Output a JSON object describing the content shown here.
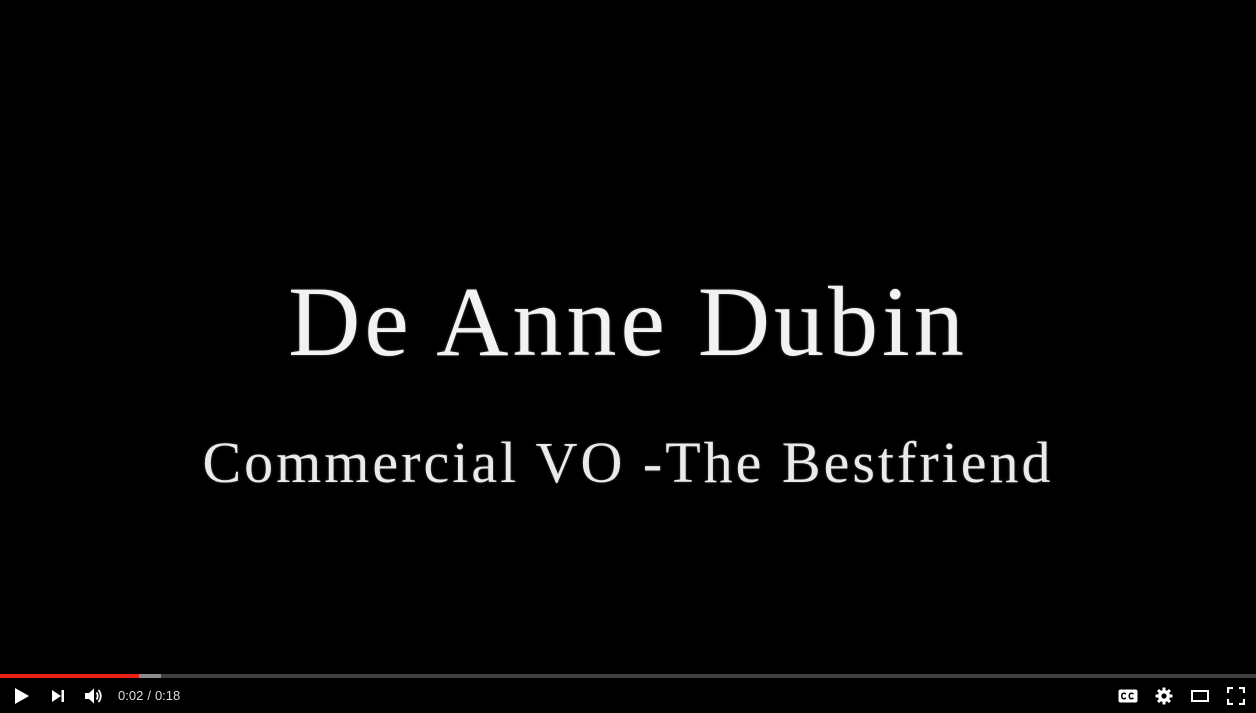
{
  "video": {
    "title_line1": "De Anne Dubin",
    "title_line2": "Commercial VO -The Bestfriend"
  },
  "player": {
    "current_time": "0:02",
    "separator": "/",
    "duration": "0:18",
    "progress_played_fraction": 0.111,
    "progress_loaded_fraction": 0.128,
    "accent_color": "#e62117"
  },
  "controls": {
    "left": [
      "play-icon",
      "next-icon",
      "volume-icon"
    ],
    "right": [
      "captions-icon",
      "settings-gear-icon",
      "theater-mode-icon",
      "fullscreen-icon"
    ]
  }
}
